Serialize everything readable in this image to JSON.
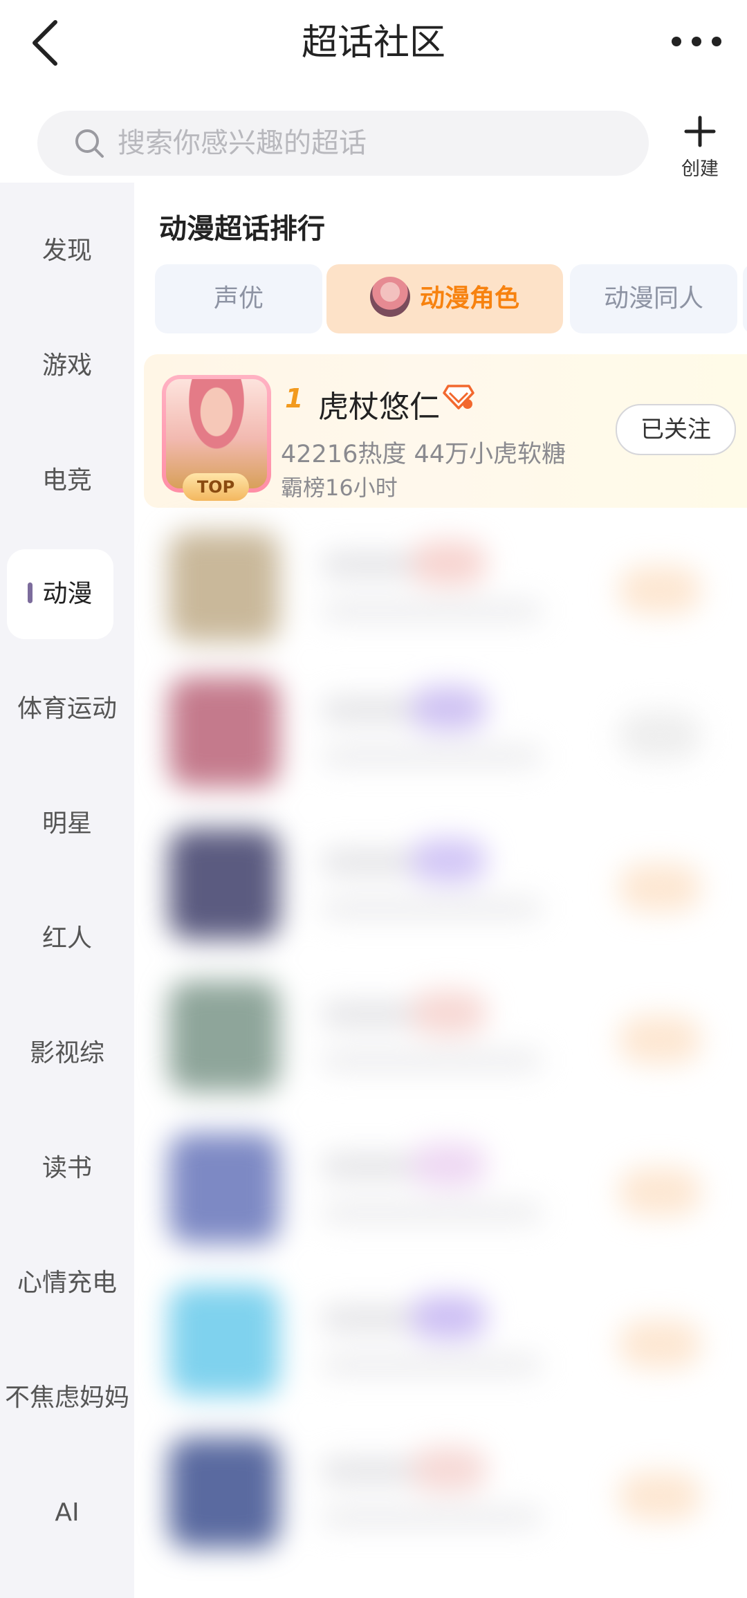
{
  "header": {
    "title": "超话社区",
    "back_icon": "chevron-left-icon",
    "more_icon": "more-dots-icon"
  },
  "search": {
    "placeholder": "搜索你感兴趣的超话",
    "create_label": "创建"
  },
  "sidebar": {
    "items": [
      {
        "label": "发现"
      },
      {
        "label": "游戏"
      },
      {
        "label": "电竞"
      },
      {
        "label": "动漫",
        "active": true
      },
      {
        "label": "体育运动"
      },
      {
        "label": "明星"
      },
      {
        "label": "红人"
      },
      {
        "label": "影视综"
      },
      {
        "label": "读书"
      },
      {
        "label": "心情充电"
      },
      {
        "label": "不焦虑妈妈"
      },
      {
        "label": "AI"
      }
    ]
  },
  "main": {
    "section_title": "动漫超话排行",
    "tabs": [
      {
        "label": "声优"
      },
      {
        "label": "动漫角色",
        "active": true
      },
      {
        "label": "动漫同人"
      }
    ],
    "top_item": {
      "rank": "1",
      "name": "虎杖悠仁",
      "stats": "42216热度 44万小虎软糖",
      "note": "霸榜16小时",
      "badge": "TOP",
      "follow_label": "已关注"
    }
  },
  "colors": {
    "accent": "#f7820f",
    "sidebar_bg": "#f4f4f8",
    "active_tab_bg": "#fde2c8",
    "plain_tab_bg": "#f2f5fb"
  }
}
